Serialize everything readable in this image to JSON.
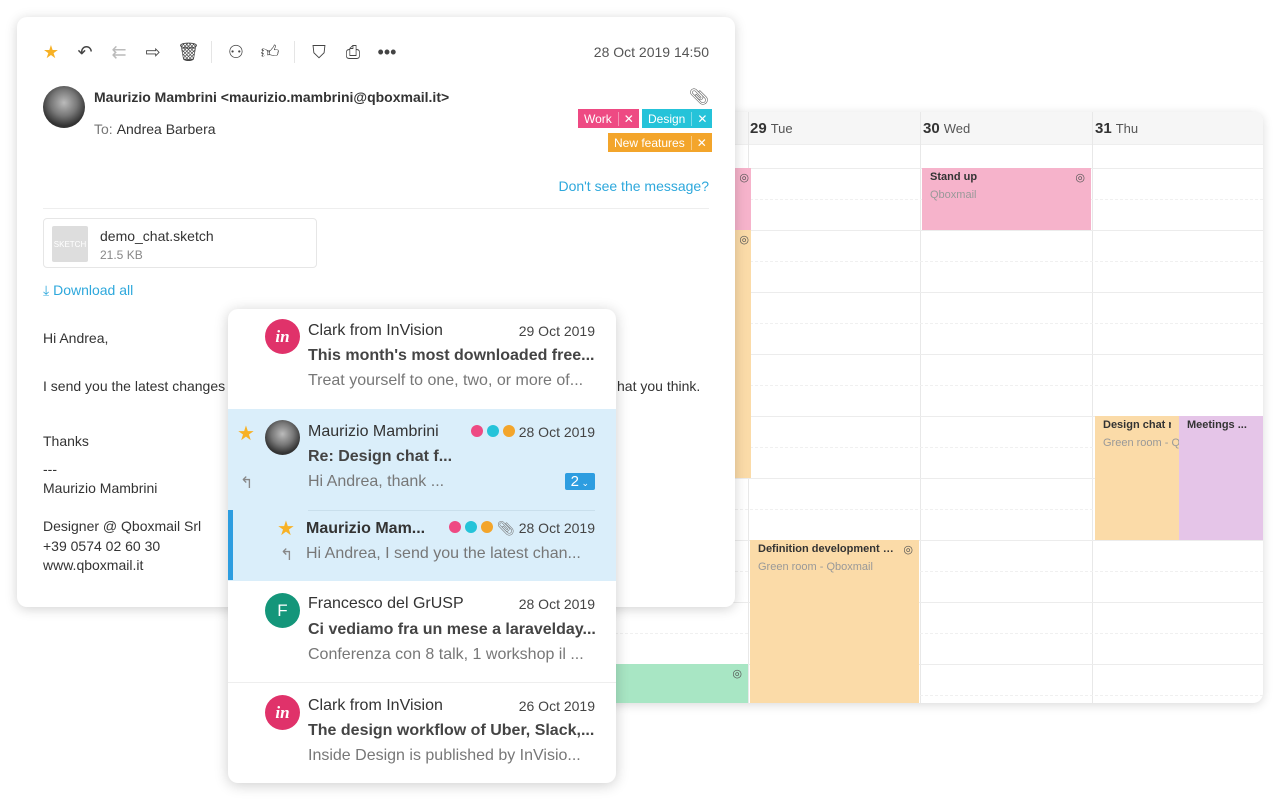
{
  "calendar": {
    "days": [
      {
        "num": "29",
        "name": "Tue"
      },
      {
        "num": "30",
        "name": "Wed"
      },
      {
        "num": "31",
        "name": "Thu"
      }
    ],
    "events": [
      {
        "title": "Stand up",
        "subtitle": "Qboxmail",
        "color": "#f6b3cb"
      },
      {
        "title": "Design chat revi",
        "subtitle": "Green room - Qb",
        "color": "#fbdba8"
      },
      {
        "title": "Meetings ...",
        "subtitle": "",
        "color": "#e5c5e8"
      },
      {
        "title": "Definition development p...",
        "subtitle": "Green room - Qboxmail",
        "color": "#fbdba8"
      }
    ]
  },
  "mail": {
    "toolbar": [
      "star-icon",
      "reply-icon",
      "reply-all-icon",
      "forward-icon",
      "trash-icon",
      "handshake-icon",
      "thumbs-up-icon",
      "shield-icon",
      "print-icon",
      "more-icon"
    ],
    "date": "28 Oct 2019 14:50",
    "from": "Maurizio Mambrini <maurizio.mambrini@qboxmail.it>",
    "to_label": "To:",
    "to": "Andrea Barbera",
    "tags": [
      {
        "label": "Work",
        "color": "#ee4a83"
      },
      {
        "label": "Design",
        "color": "#25c3d9"
      },
      {
        "label": "New features",
        "color": "#f3a52b"
      }
    ],
    "dont_see": "Don't see the message?",
    "attachment": {
      "name": "demo_chat.sketch",
      "size": "21.5 KB",
      "icon_label": "SKETCH"
    },
    "download_all": "Download all",
    "body": {
      "greeting": "Hi Andrea,",
      "line1_start": "I send you the latest changes t",
      "line1_end": "hat you think.",
      "thanks": "Thanks",
      "dashes": "---",
      "sig_name": "Maurizio Mambrini",
      "sig_role": "Designer @ Qboxmail Srl",
      "sig_phone": "+39 0574 02 60 30",
      "sig_web": "www.qboxmail.it"
    }
  },
  "list": {
    "items": [
      {
        "name": "Clark from InVision",
        "date": "29 Oct 2019",
        "subject": "This month's most downloaded free...",
        "preview": "Treat yourself to one, two, or more of...",
        "avatar": "in"
      },
      {
        "name": "Maurizio Mambrini",
        "date": "28 Oct 2019",
        "subject": "Re: Design chat f...",
        "preview": "Hi Andrea, thank ...",
        "count": "2"
      },
      {
        "name": "Maurizio Mam...",
        "date": "28 Oct 2019",
        "preview": "Hi Andrea, I send you the latest chan..."
      },
      {
        "name": "Francesco del GrUSP",
        "date": "28 Oct 2019",
        "subject": "Ci vediamo fra un mese a laravelday...",
        "preview": "Conferenza con 8 talk, 1 workshop il ...",
        "avatar": "F"
      },
      {
        "name": "Clark from InVision",
        "date": "26 Oct 2019",
        "subject": "The design workflow of Uber, Slack,...",
        "preview": "Inside Design is published by InVisio...",
        "avatar": "in"
      }
    ]
  }
}
